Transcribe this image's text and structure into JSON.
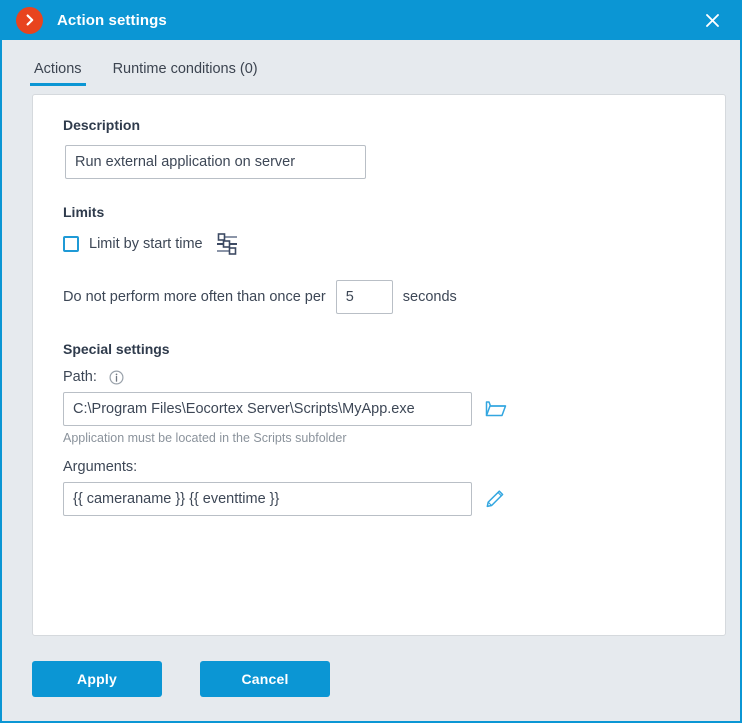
{
  "window": {
    "title": "Action settings",
    "app_icon": "chevron-right-circle-icon",
    "close_icon": "close-icon",
    "accent_color": "#0b96d4",
    "badge_color": "#e8441e"
  },
  "tabs": [
    {
      "label": "Actions",
      "active": true
    },
    {
      "label": "Runtime conditions (0)",
      "active": false
    }
  ],
  "form": {
    "description": {
      "heading": "Description",
      "value": "Run external application on server",
      "placeholder": ""
    },
    "limits": {
      "heading": "Limits",
      "checkbox_label": "Limit by start time",
      "checkbox_checked": false,
      "sliders_icon": "sliders-icon",
      "frequency_prefix": "Do not perform more often than once per",
      "frequency_value": "5",
      "frequency_suffix": "seconds"
    },
    "special": {
      "heading": "Special settings",
      "path_label": "Path:",
      "path_info_icon": "info-icon",
      "path_value": "C:\\Program Files\\Eocortex Server\\Scripts\\MyApp.exe",
      "path_browse_icon": "folder-icon",
      "path_hint": "Application must be located in the Scripts subfolder",
      "arguments_label": "Arguments:",
      "arguments_value": "{{ cameraname }} {{ eventtime }}",
      "arguments_edit_icon": "pencil-icon"
    }
  },
  "footer": {
    "apply_label": "Apply",
    "cancel_label": "Cancel"
  }
}
